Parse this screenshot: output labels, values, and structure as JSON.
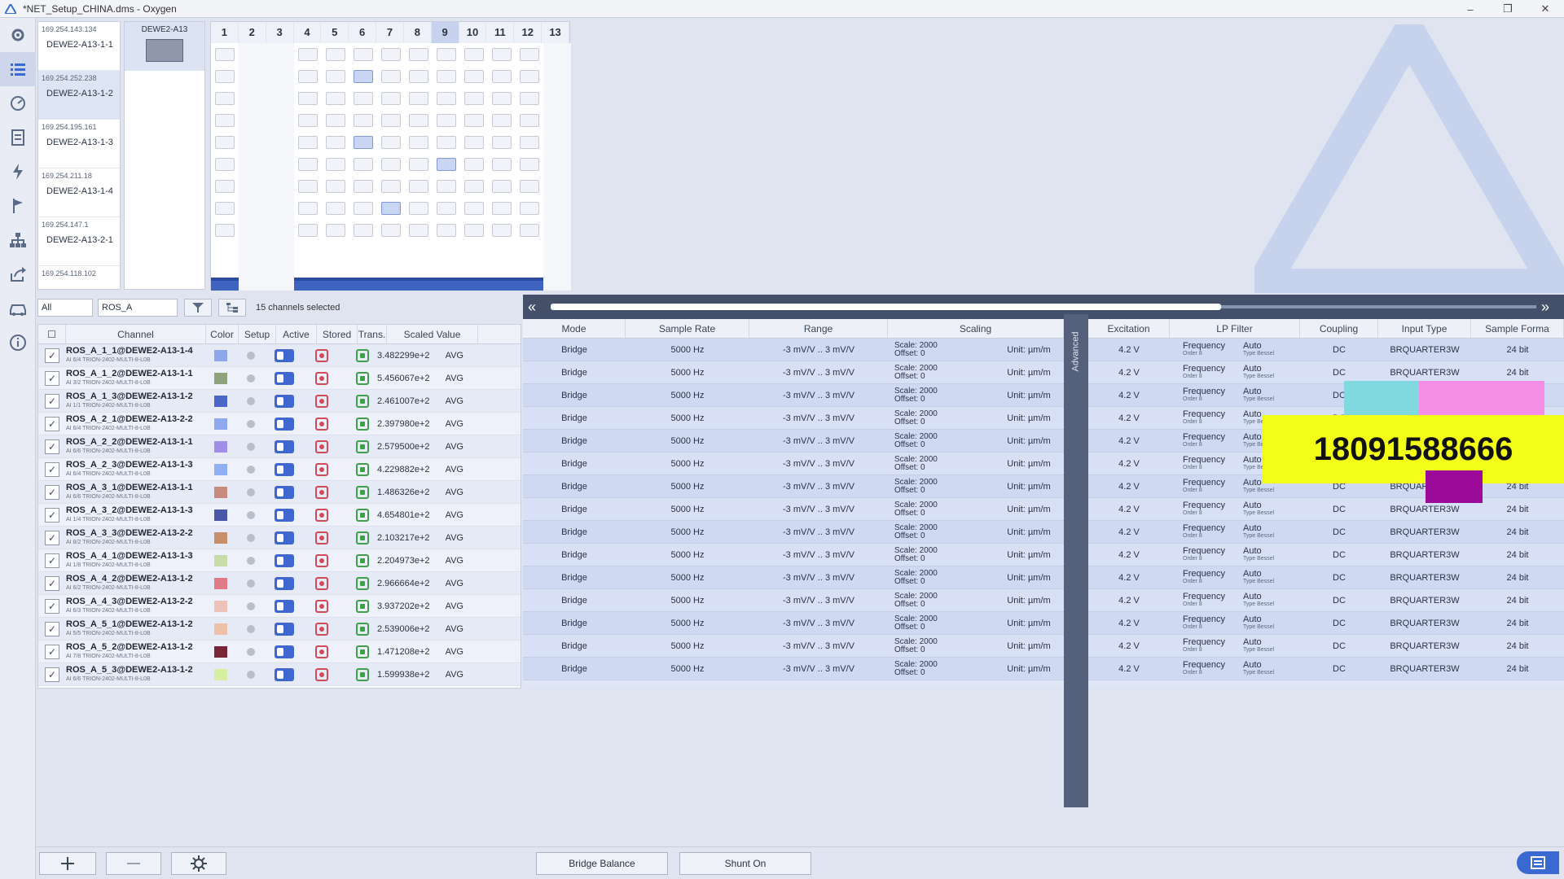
{
  "window": {
    "title": "*NET_Setup_CHINA.dms - Oxygen",
    "minimize": "–",
    "restore": "❐",
    "close": "✕"
  },
  "devices": [
    {
      "ip": "169.254.143.134",
      "name": "DEWE2-A13-1-1"
    },
    {
      "ip": "169.254.252.238",
      "name": "DEWE2-A13-1-2"
    },
    {
      "ip": "169.254.195.161",
      "name": "DEWE2-A13-1-3"
    },
    {
      "ip": "169.254.211.18",
      "name": "DEWE2-A13-1-4"
    },
    {
      "ip": "169.254.147.1",
      "name": "DEWE2-A13-2-1"
    },
    {
      "ip": "169.254.118.102",
      "name": ""
    }
  ],
  "device_card": {
    "title": "DEWE2-A13"
  },
  "slots": [
    "1",
    "2",
    "3",
    "4",
    "5",
    "6",
    "7",
    "8",
    "9",
    "10",
    "11",
    "12",
    "13"
  ],
  "filter": {
    "scope": "All",
    "text": "ROS_A",
    "clear": "x",
    "selected": "15 channels selected"
  },
  "left_headers": {
    "channel": "Channel",
    "color": "Color",
    "setup": "Setup",
    "active": "Active",
    "stored": "Stored",
    "trans": "Trans.",
    "scaled": "Scaled Value"
  },
  "right_headers": {
    "mode": "Mode",
    "rate": "Sample Rate",
    "range": "Range",
    "scaling": "Scaling",
    "excitation": "Excitation",
    "lp": "LP Filter",
    "coupling": "Coupling",
    "input": "Input Type",
    "format": "Sample Forma"
  },
  "advanced_label": "Advanced",
  "rows": [
    {
      "name": "ROS_A_1_1@DEWE2-A13-1-4",
      "sub": "AI 6/4        TRION-2402-MULTI-8-L0B",
      "color": "#8fa6ec",
      "value": "3.482299e+2",
      "avg": "AVG"
    },
    {
      "name": "ROS_A_1_2@DEWE2-A13-1-1",
      "sub": "AI 3/2        TRION-2402-MULTI-8-L0B",
      "color": "#8ea27c",
      "value": "5.456067e+2",
      "avg": "AVG"
    },
    {
      "name": "ROS_A_1_3@DEWE2-A13-1-2",
      "sub": "AI 1/1        TRION-2402-MULTI-8-L0B",
      "color": "#4a66c8",
      "value": "2.461007e+2",
      "avg": "AVG"
    },
    {
      "name": "ROS_A_2_1@DEWE2-A13-2-2",
      "sub": "AI 6/4        TRION-2402-MULTI-8-L0B",
      "color": "#8ea8f0",
      "value": "2.397980e+2",
      "avg": "AVG"
    },
    {
      "name": "ROS_A_2_2@DEWE2-A13-1-1",
      "sub": "AI 6/6        TRION-2402-MULTI-8-L0B",
      "color": "#a08ee8",
      "value": "2.579500e+2",
      "avg": "AVG"
    },
    {
      "name": "ROS_A_2_3@DEWE2-A13-1-3",
      "sub": "AI 6/4        TRION-2402-MULTI-8-L0B",
      "color": "#8fb0f2",
      "value": "4.229882e+2",
      "avg": "AVG"
    },
    {
      "name": "ROS_A_3_1@DEWE2-A13-1-1",
      "sub": "AI 6/6        TRION-2402-MULTI-8-L0B",
      "color": "#c88a7c",
      "value": "1.486326e+2",
      "avg": "AVG"
    },
    {
      "name": "ROS_A_3_2@DEWE2-A13-1-3",
      "sub": "AI 1/4        TRION-2402-MULTI-8-L0B",
      "color": "#4a56a8",
      "value": "4.654801e+2",
      "avg": "AVG"
    },
    {
      "name": "ROS_A_3_3@DEWE2-A13-2-2",
      "sub": "AI 8/2        TRION-2402-MULTI-8-L0B",
      "color": "#c88e6a",
      "value": "2.103217e+2",
      "avg": "AVG"
    },
    {
      "name": "ROS_A_4_1@DEWE2-A13-1-3",
      "sub": "AI 1/8        TRION-2402-MULTI-8-L0B",
      "color": "#c8dca8",
      "value": "2.204973e+2",
      "avg": "AVG"
    },
    {
      "name": "ROS_A_4_2@DEWE2-A13-1-2",
      "sub": "AI 6/2        TRION-2402-MULTI-8-L0B",
      "color": "#e07a86",
      "value": "2.966664e+2",
      "avg": "AVG"
    },
    {
      "name": "ROS_A_4_3@DEWE2-A13-2-2",
      "sub": "AI 6/3        TRION-2402-MULTI-8-L0B",
      "color": "#eec2b8",
      "value": "3.937202e+2",
      "avg": "AVG"
    },
    {
      "name": "ROS_A_5_1@DEWE2-A13-1-2",
      "sub": "AI 5/5        TRION-2402-MULTI-8-L0B",
      "color": "#eec0a8",
      "value": "2.539006e+2",
      "avg": "AVG"
    },
    {
      "name": "ROS_A_5_2@DEWE2-A13-1-2",
      "sub": "AI 7/8        TRION-2402-MULTI-8-L0B",
      "color": "#7a2438",
      "value": "1.471208e+2",
      "avg": "AVG"
    },
    {
      "name": "ROS_A_5_3@DEWE2-A13-1-2",
      "sub": "AI 6/6        TRION-2402-MULTI-8-L0B",
      "color": "#d6eea0",
      "value": "1.599938e+2",
      "avg": "AVG"
    }
  ],
  "row_common": {
    "mode": "Bridge",
    "rate": "5000 Hz",
    "range": "-3 mV/V .. 3 mV/V",
    "scale": "Scale: 2000",
    "offset": "Offset: 0",
    "unit": "Unit: µm/m",
    "excitation": "4.2 V",
    "lp_type": "Frequency",
    "lp_order": "Order 8",
    "lp_auto": "Auto",
    "lp_bessel": "Type Bessel",
    "coupling": "DC",
    "input": "BRQUARTER3W",
    "format": "24 bit"
  },
  "overlay": {
    "phone": "18091588666"
  },
  "bottom": {
    "bridge_balance": "Bridge Balance",
    "shunt_on": "Shunt On"
  },
  "colors": {
    "accent": "#3f67cf",
    "rail": "#e9ecf4",
    "nav": "#44506a"
  }
}
